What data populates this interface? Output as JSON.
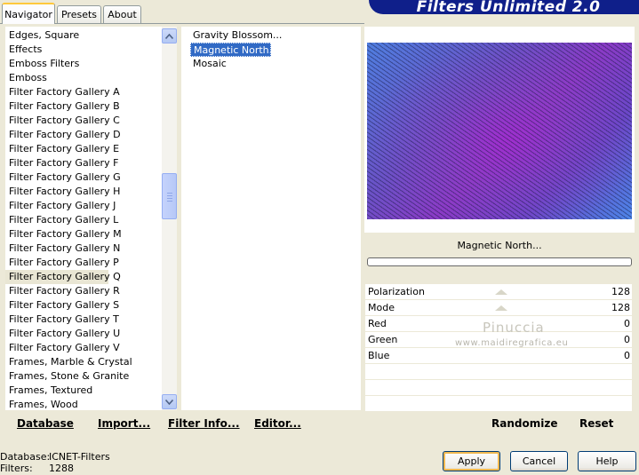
{
  "tabs": [
    {
      "label": "Navigator",
      "active": true
    },
    {
      "label": "Presets",
      "active": false
    },
    {
      "label": "About",
      "active": false
    }
  ],
  "banner": {
    "title": "Filters Unlimited 2.0"
  },
  "categories": {
    "items": [
      "Edges, Square",
      "Effects",
      "Emboss Filters",
      "Emboss",
      "Filter Factory Gallery A",
      "Filter Factory Gallery B",
      "Filter Factory Gallery C",
      "Filter Factory Gallery D",
      "Filter Factory Gallery E",
      "Filter Factory Gallery F",
      "Filter Factory Gallery G",
      "Filter Factory Gallery H",
      "Filter Factory Gallery J",
      "Filter Factory Gallery L",
      "Filter Factory Gallery M",
      "Filter Factory Gallery N",
      "Filter Factory Gallery P",
      "Filter Factory Gallery Q",
      "Filter Factory Gallery R",
      "Filter Factory Gallery S",
      "Filter Factory Gallery T",
      "Filter Factory Gallery U",
      "Filter Factory Gallery V",
      "Frames, Marble & Crystal",
      "Frames, Stone & Granite",
      "Frames, Textured",
      "Frames, Wood"
    ],
    "selected": "Filter Factory Gallery Q"
  },
  "filters": {
    "items": [
      "Gravity Blossom...",
      "Magnetic North...",
      "Mosaic"
    ],
    "selected": "Magnetic North..."
  },
  "preview": {
    "filter_name": "Magnetic North..."
  },
  "parameters": [
    {
      "label": "Polarization",
      "value": "128"
    },
    {
      "label": "Mode",
      "value": "128"
    },
    {
      "label": "Red",
      "value": "0"
    },
    {
      "label": "Green",
      "value": "0"
    },
    {
      "label": "Blue",
      "value": "0"
    }
  ],
  "watermark": {
    "title": "Pinuccia",
    "url": "www.maidiregrafica.eu"
  },
  "bottom_links": {
    "database": "Database",
    "import": "Import...",
    "filter_info": "Filter Info...",
    "editor": "Editor...",
    "randomize": "Randomize",
    "reset": "Reset"
  },
  "status": {
    "database_label": "Database:",
    "database_value": "ICNET-Filters",
    "filters_label": "Filters:",
    "filters_value": "1288"
  },
  "buttons": {
    "apply": "Apply",
    "cancel": "Cancel",
    "help": "Help"
  },
  "icons": {
    "scroll_up": "arrow-up-icon",
    "scroll_down": "arrow-down-icon"
  }
}
